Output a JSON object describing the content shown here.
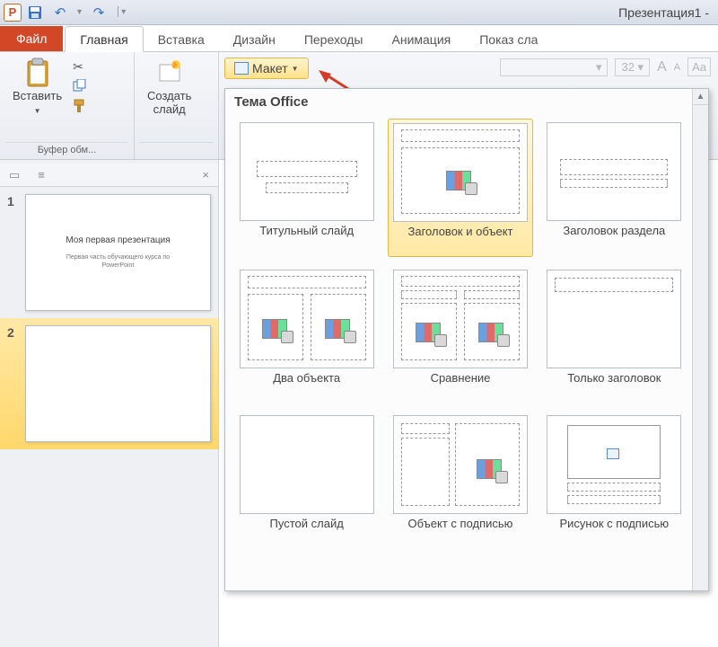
{
  "titlebar": {
    "title": "Презентация1 -"
  },
  "tabs": {
    "file": "Файл",
    "items": [
      "Главная",
      "Вставка",
      "Дизайн",
      "Переходы",
      "Анимация",
      "Показ сла"
    ],
    "active_index": 0
  },
  "ribbon": {
    "clipboard": {
      "paste": "Вставить",
      "group_label": "Буфер обм..."
    },
    "slides": {
      "new_slide": "Создать\nслайд",
      "layout_btn": "Макет"
    },
    "font_size_placeholder": "32"
  },
  "gallery": {
    "theme_label": "Тема Office",
    "layouts": [
      {
        "name": "Титульный слайд",
        "type": "title"
      },
      {
        "name": "Заголовок и объект",
        "type": "title_content",
        "selected": true
      },
      {
        "name": "Заголовок раздела",
        "type": "section"
      },
      {
        "name": "Два объекта",
        "type": "two_content"
      },
      {
        "name": "Сравнение",
        "type": "comparison"
      },
      {
        "name": "Только заголовок",
        "type": "title_only"
      },
      {
        "name": "Пустой слайд",
        "type": "blank"
      },
      {
        "name": "Объект с подписью",
        "type": "content_caption"
      },
      {
        "name": "Рисунок с подписью",
        "type": "picture_caption"
      }
    ]
  },
  "slidepanel": {
    "slides": [
      {
        "num": "1",
        "title": "Моя первая презентация",
        "subtitle": "Первая часть обучающего курса по\nPowerPoint"
      },
      {
        "num": "2",
        "title": "",
        "subtitle": "",
        "selected": true
      }
    ]
  }
}
